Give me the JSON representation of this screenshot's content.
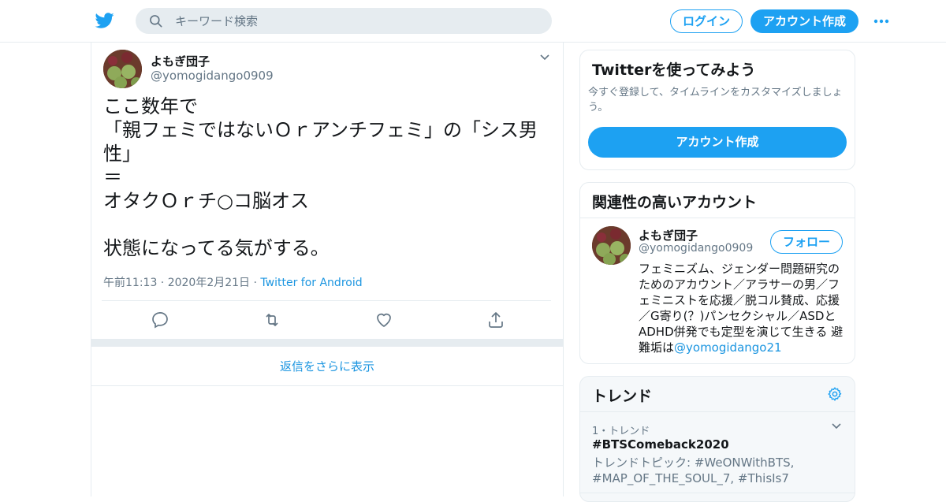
{
  "header": {
    "search_placeholder": "キーワード検索",
    "login_label": "ログイン",
    "signup_label": "アカウント作成"
  },
  "tweet": {
    "author_name": "よもぎ団子",
    "author_handle": "@yomogidango0909",
    "text": "ここ数年で\n「親フェミではないＯｒアンチフェミ」の「シス男性」\n＝\nオタクＯｒチ○コ脳オス\n\n状態になってる気がする。",
    "time": "午前11:13 · 2020年2月21日 · ",
    "source": "Twitter for Android",
    "more_replies": "返信をさらに表示"
  },
  "signup_card": {
    "title": "Twitterを使ってみよう",
    "description": "今すぐ登録して、タイムラインをカスタマイズしましょう。",
    "button_label": "アカウント作成"
  },
  "related": {
    "title": "関連性の高いアカウント",
    "account": {
      "name": "よもぎ団子",
      "handle": "@yomogidango0909",
      "follow_label": "フォロー",
      "bio": "フェミニズム、ジェンダー問題研究のためのアカウント／アラサーの男／フェミニストを応援／脱コル賛成、応援／G寄り(？)パンセクシャル／ASDとADHD併発でも定型を演じて生きる 避難垢は",
      "bio_mention": "@yomogidango21"
    }
  },
  "trends": {
    "title": "トレンド",
    "items": [
      {
        "rank_label": "1・トレンド",
        "tag": "#BTSComeback2020",
        "topics": "トレンドトピック: #WeONWithBTS, #MAP_OF_THE_SOUL_7, #ThisIs7"
      }
    ]
  },
  "colors": {
    "accent": "#1da1f2",
    "link": "#1b95e0",
    "muted": "#657786",
    "border": "#e6ecf0"
  },
  "icons": [
    "twitter-logo-icon",
    "search-icon",
    "more-dots-icon",
    "chevron-down-icon",
    "reply-icon",
    "retweet-icon",
    "like-icon",
    "share-icon",
    "gear-icon"
  ]
}
